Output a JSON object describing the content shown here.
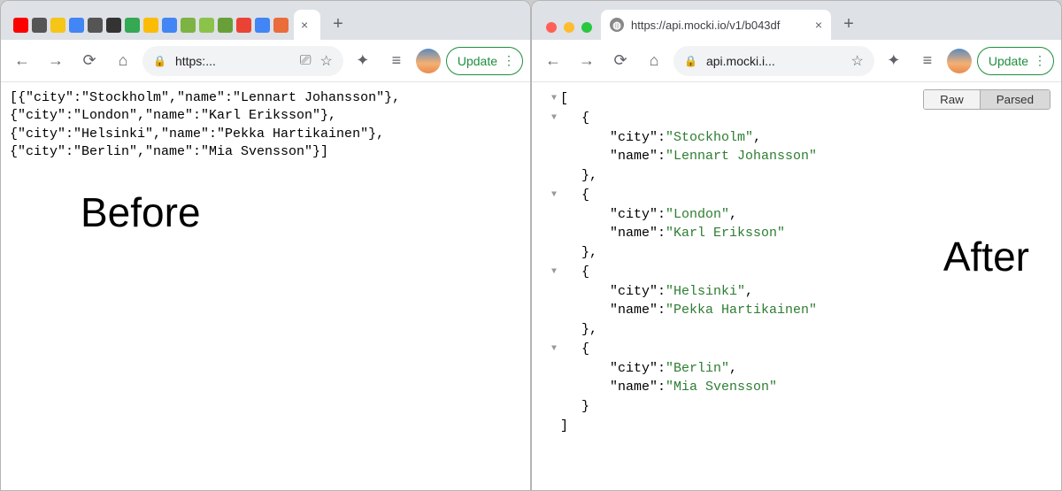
{
  "left": {
    "pinned_icons": [
      "yt",
      "mute",
      "postit",
      "g1",
      "globe",
      "panda",
      "g2",
      "g3",
      "G",
      "leaf1",
      "leaf2",
      "leaf3",
      "G2",
      "g4",
      "mail"
    ],
    "tab": {
      "title": "",
      "close_label": "×"
    },
    "newtab_label": "+",
    "toolbar": {
      "back": "←",
      "fwd": "→",
      "reload": "⟳",
      "home": "⌂",
      "lock": "🔒",
      "address": "https:...",
      "screen_icon": "⎚",
      "star": "☆",
      "ext": "✦",
      "list": "≡"
    },
    "update_label": "Update",
    "update_menu": "⋮",
    "before_label": "Before",
    "raw_lines": [
      "[{\"city\":\"Stockholm\",\"name\":\"Lennart Johansson\"},",
      "{\"city\":\"London\",\"name\":\"Karl Eriksson\"},",
      "{\"city\":\"Helsinki\",\"name\":\"Pekka Hartikainen\"},",
      "{\"city\":\"Berlin\",\"name\":\"Mia Svensson\"}]"
    ]
  },
  "right": {
    "tab": {
      "title": "https://api.mocki.io/v1/b043df",
      "close_label": "×"
    },
    "newtab_label": "+",
    "toolbar": {
      "back": "←",
      "fwd": "→",
      "reload": "⟳",
      "home": "⌂",
      "lock": "🔒",
      "address": "api.mocki.i...",
      "star": "☆",
      "ext": "✦",
      "list": "≡"
    },
    "update_label": "Update",
    "update_menu": "⋮",
    "after_label": "After",
    "toggle": {
      "raw": "Raw",
      "parsed": "Parsed"
    },
    "items": [
      {
        "city": "Stockholm",
        "name": "Lennart Johansson"
      },
      {
        "city": "London",
        "name": "Karl Eriksson"
      },
      {
        "city": "Helsinki",
        "name": "Pekka Hartikainen"
      },
      {
        "city": "Berlin",
        "name": "Mia Svensson"
      }
    ],
    "labels": {
      "city_key": "\"city\"",
      "name_key": "\"name\"",
      "colon": ": "
    }
  },
  "icon_colors": {
    "yt": "#ff0000",
    "mute": "#555",
    "postit": "#f5c518",
    "g1": "#4285f4",
    "globe": "#555",
    "panda": "#333",
    "g2": "#34a853",
    "g3": "#fbbc05",
    "G": "#4285f4",
    "leaf1": "#7cb342",
    "leaf2": "#8bc34a",
    "leaf3": "#689f38",
    "G2": "#ea4335",
    "g4": "#4285f4",
    "mail": "#ea6c3a"
  }
}
